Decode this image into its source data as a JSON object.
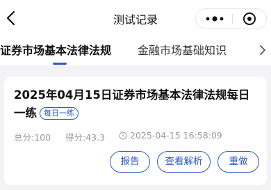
{
  "header": {
    "title": "测试记录"
  },
  "tabs": [
    {
      "label": "证券市场基本法律法规",
      "active": true
    },
    {
      "label": "金融市场基础知识",
      "active": false
    }
  ],
  "records": [
    {
      "title": "2025年04月15日证券市场基本法律法规每日一练",
      "badge": "每日一练",
      "total": "总分:100",
      "score": "得分:43.3",
      "time": "2025-04-15 16:58:09",
      "actions": {
        "report": "报告",
        "review": "查看解析",
        "redo": "重做"
      }
    }
  ],
  "colors": {
    "accent": "#2f59c4",
    "background": "#f3f3f5",
    "meta_text": "#9a9a9a"
  },
  "icons": {
    "back": "chevron-left-icon",
    "more": "more-dots-icon",
    "close": "target-close-icon",
    "tab_more": "chevron-right-icon",
    "time": "clock-icon"
  }
}
